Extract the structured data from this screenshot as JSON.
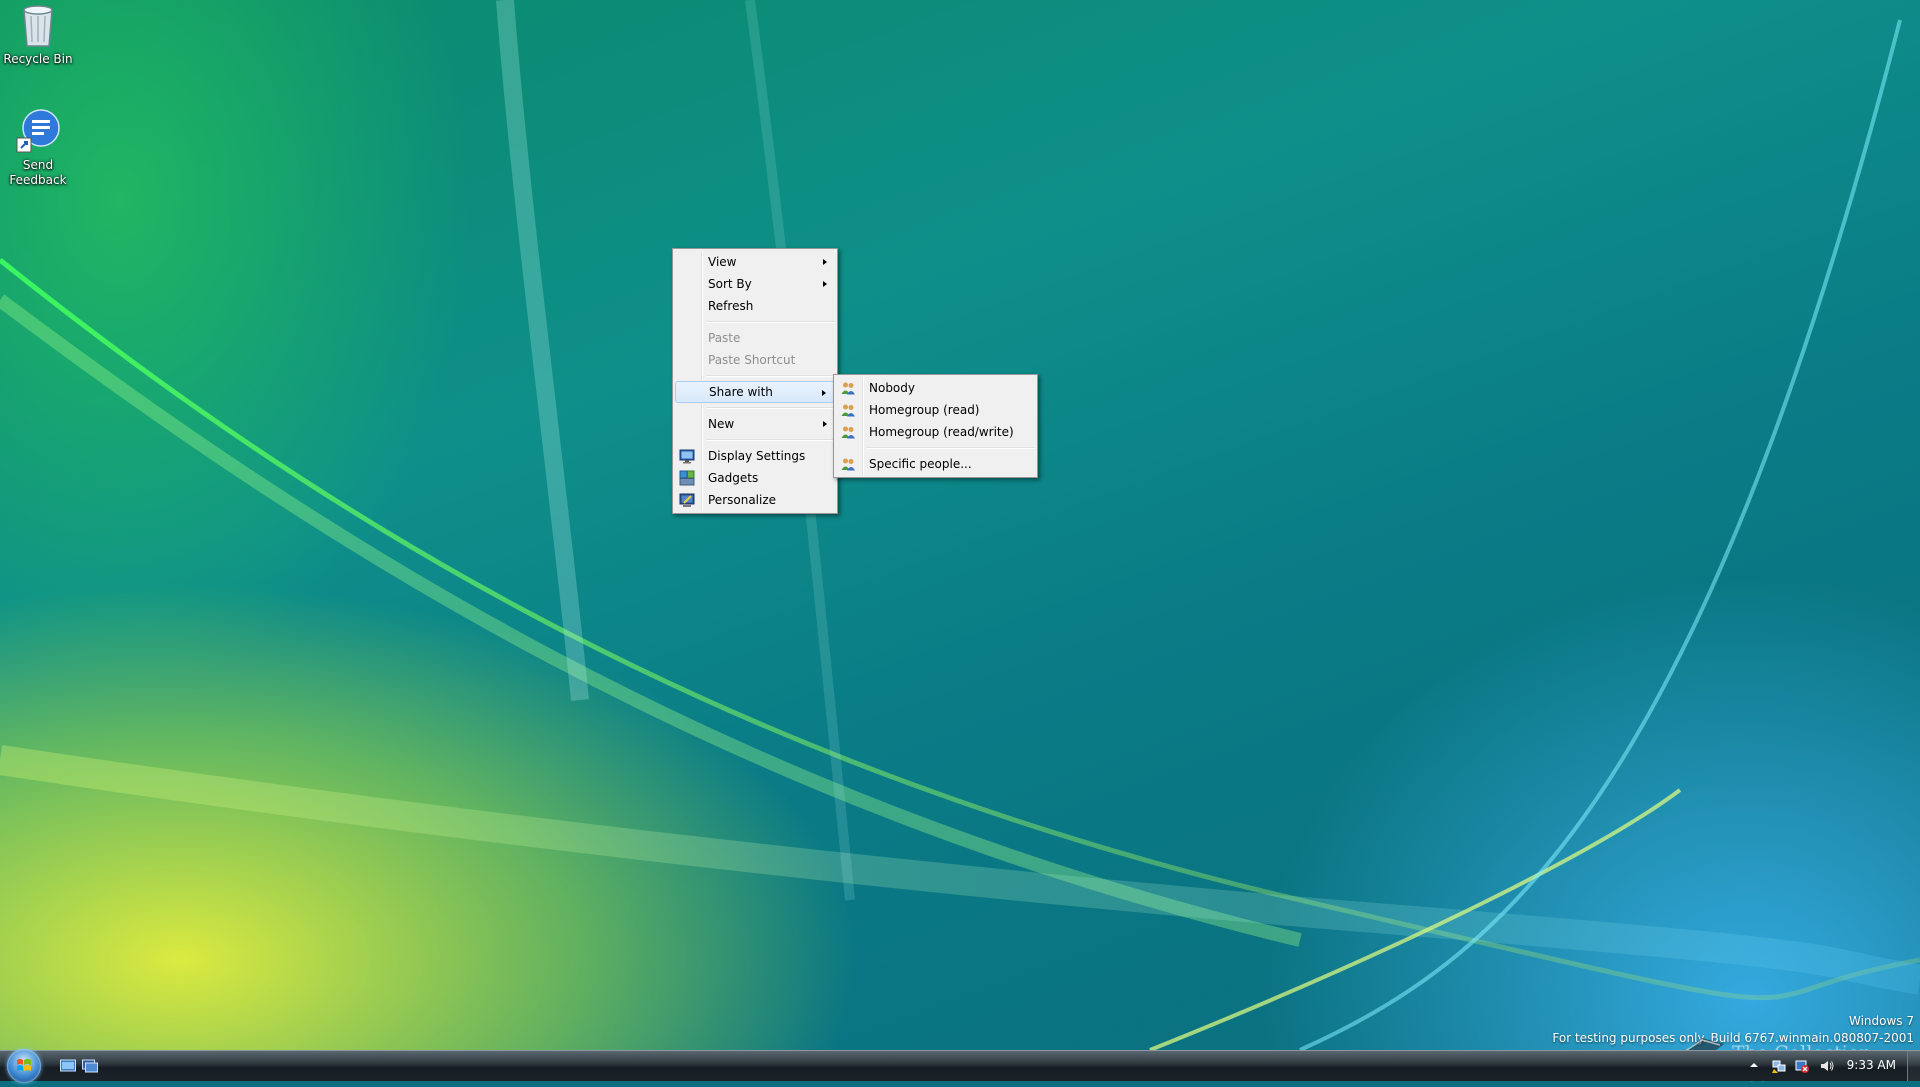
{
  "desktop": {
    "icons": [
      {
        "label": "Recycle Bin"
      },
      {
        "label": "Send Feedback"
      }
    ]
  },
  "context_menu": {
    "items": [
      {
        "label": "View"
      },
      {
        "label": "Sort By"
      },
      {
        "label": "Refresh"
      },
      {
        "label": "Paste"
      },
      {
        "label": "Paste Shortcut"
      },
      {
        "label": "Share with"
      },
      {
        "label": "New"
      },
      {
        "label": "Display Settings"
      },
      {
        "label": "Gadgets"
      },
      {
        "label": "Personalize"
      }
    ]
  },
  "share_submenu": {
    "items": [
      {
        "label": "Nobody"
      },
      {
        "label": "Homegroup (read)"
      },
      {
        "label": "Homegroup (read/write)"
      },
      {
        "label": "Specific people..."
      }
    ]
  },
  "watermark": {
    "product": "Windows 7",
    "build": "For testing purposes only. Build 6767.winmain.080807-2001"
  },
  "site_mark": "The Collection Book",
  "taskbar": {
    "clock": "9:33 AM"
  },
  "icons": {
    "recycle_bin": "recycle-bin-icon",
    "send_feedback": "feedback-icon",
    "share": "people-icon",
    "display": "display-settings-icon",
    "gadgets": "gadgets-icon",
    "personalize": "personalize-icon"
  },
  "colors": {
    "menu_bg": "#f0f0f0",
    "menu_highlight": "#d8e9fb",
    "disabled_text": "#8e8e8e",
    "taskbar": "#1b2329"
  }
}
